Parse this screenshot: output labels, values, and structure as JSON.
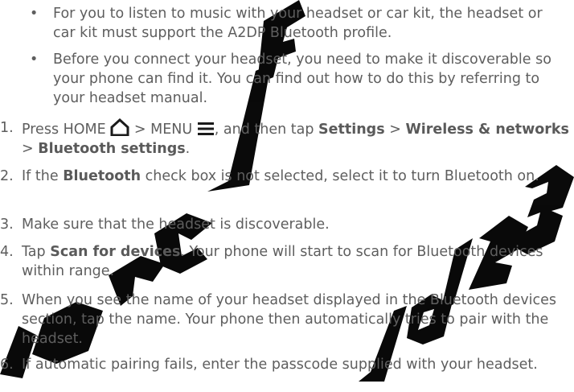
{
  "bullets": [
    {
      "symbol": "•",
      "text": "For you to listen to music with your headset or car kit, the headset or car kit must support the A2DP Bluetooth profile."
    },
    {
      "symbol": "•",
      "text": "Before you connect your headset, you need to make it discoverable so your phone can find it. You can find out how to do this by referring to your headset manual."
    }
  ],
  "steps": [
    {
      "num": "1.",
      "parts": {
        "a": "Press HOME",
        "b": "> MENU",
        "c": ", and then tap",
        "settings": "Settings",
        "gt1": ">",
        "wireless": "Wireless & networks",
        "gt2": ">",
        "bt_settings": "Bluetooth settings",
        "end": "."
      }
    },
    {
      "num": "2.",
      "parts": {
        "a": "If the",
        "bluetooth": "Bluetooth",
        "b": "check box is not selected, select it to turn Bluetooth on."
      }
    },
    {
      "num": "3.",
      "text": "Make sure that the headset is discoverable."
    },
    {
      "num": "4.",
      "parts": {
        "a": "Tap",
        "scan": "Scan for devices",
        "b": ". Your phone will start to scan for Bluetooth devices within range."
      }
    },
    {
      "num": "5.",
      "text": "When you see the name of your headset displayed in the Bluetooth devices section, tap the name. Your phone then automatically tries to pair with the headset."
    },
    {
      "num": "6.",
      "text": "If automatic pairing fails, enter the passcode supplied with your headset."
    }
  ],
  "icons": {
    "home": "home-icon",
    "menu": "menu-icon"
  },
  "watermark": {
    "text": "For CE/FCC 2010/01/25",
    "color": "#000000"
  }
}
